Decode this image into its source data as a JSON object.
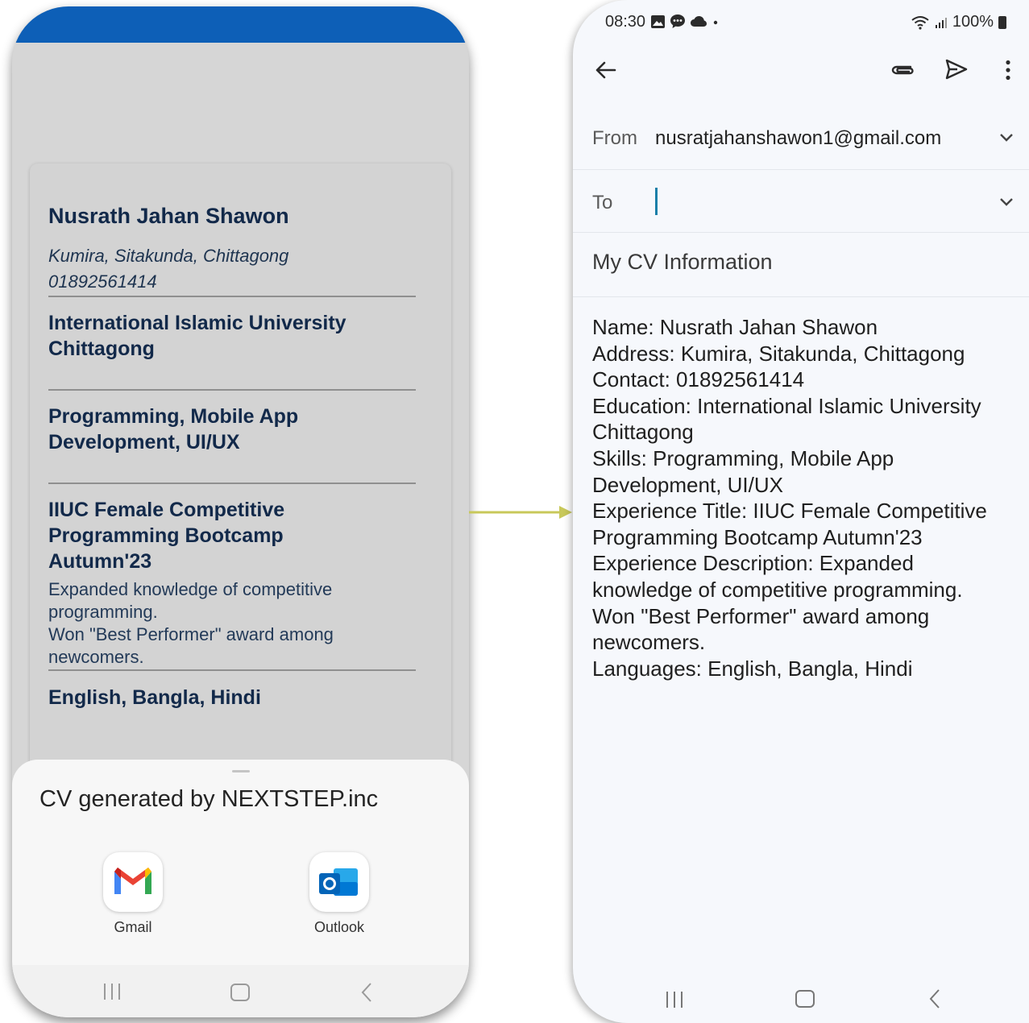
{
  "left_phone": {
    "cv": {
      "name": "Nusrath Jahan Shawon",
      "address": "Kumira, Sitakunda, Chittagong",
      "contact": "01892561414",
      "education": "International Islamic University Chittagong",
      "skills": "Programming, Mobile App Development, UI/UX",
      "experience_title": "IIUC Female Competitive Programming Bootcamp Autumn'23",
      "experience_description": "Expanded knowledge of competitive programming.\nWon \"Best Performer\" award among newcomers.",
      "languages": "English, Bangla, Hindi"
    },
    "share_sheet": {
      "title": "CV generated by NEXTSTEP.inc",
      "apps": [
        {
          "label": "Gmail",
          "icon": "gmail-icon"
        },
        {
          "label": "Outlook",
          "icon": "outlook-icon"
        }
      ]
    },
    "navbar": [
      "recents-icon",
      "home-icon",
      "back-icon"
    ]
  },
  "right_phone": {
    "status_bar": {
      "time": "08:30",
      "battery": "100%",
      "icons": [
        "gallery-icon",
        "chat-icon",
        "cloud-icon",
        "dot-icon",
        "wifi-icon",
        "signal-icon",
        "battery-icon"
      ]
    },
    "toolbar": [
      "back-arrow-icon",
      "attach-icon",
      "send-icon",
      "more-icon"
    ],
    "compose": {
      "from_label": "From",
      "from_value": "nusratjahanshawon1@gmail.com",
      "to_label": "To",
      "to_value": "",
      "subject": "My CV Information",
      "body": "Name: Nusrath Jahan Shawon\nAddress: Kumira, Sitakunda, Chittagong\nContact: 01892561414\nEducation: International Islamic University Chittagong\nSkills: Programming, Mobile App Development, UI/UX\nExperience Title: IIUC Female Competitive Programming Bootcamp Autumn'23\nExperience Description: Expanded knowledge of competitive programming.\nWon \"Best Performer\" award among newcomers.\nLanguages: English, Bangla, Hindi"
    }
  },
  "colors": {
    "header_blue": "#0d5fb7",
    "cv_text": "#12294a",
    "arrow": "#c8c85a",
    "cursor": "#1a7fa8"
  }
}
